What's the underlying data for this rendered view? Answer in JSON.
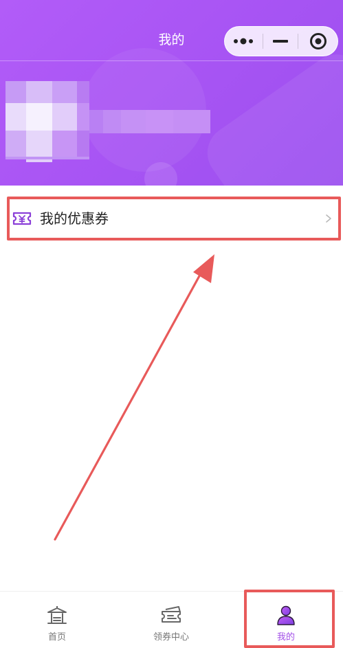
{
  "header": {
    "title": "我的",
    "capsule": {
      "more_icon": "more-dots-icon",
      "minimize_icon": "minimize-icon",
      "close_icon": "target-close-icon"
    }
  },
  "menu": {
    "coupon_item": {
      "label": "我的优惠券",
      "icon": "coupon-ticket-icon",
      "chevron": "chevron-right-icon"
    }
  },
  "tabbar": {
    "items": [
      {
        "label": "首页",
        "icon": "home-pavilion-icon",
        "active": false
      },
      {
        "label": "领券中心",
        "icon": "coupon-center-icon",
        "active": false
      },
      {
        "label": "我的",
        "icon": "user-profile-icon",
        "active": true
      }
    ]
  },
  "colors": {
    "header_gradient_start": "#b25cf8",
    "header_gradient_end": "#9b4fef",
    "accent": "#a24ee8",
    "annotation": "#e85a5a",
    "tab_inactive": "#777777"
  }
}
